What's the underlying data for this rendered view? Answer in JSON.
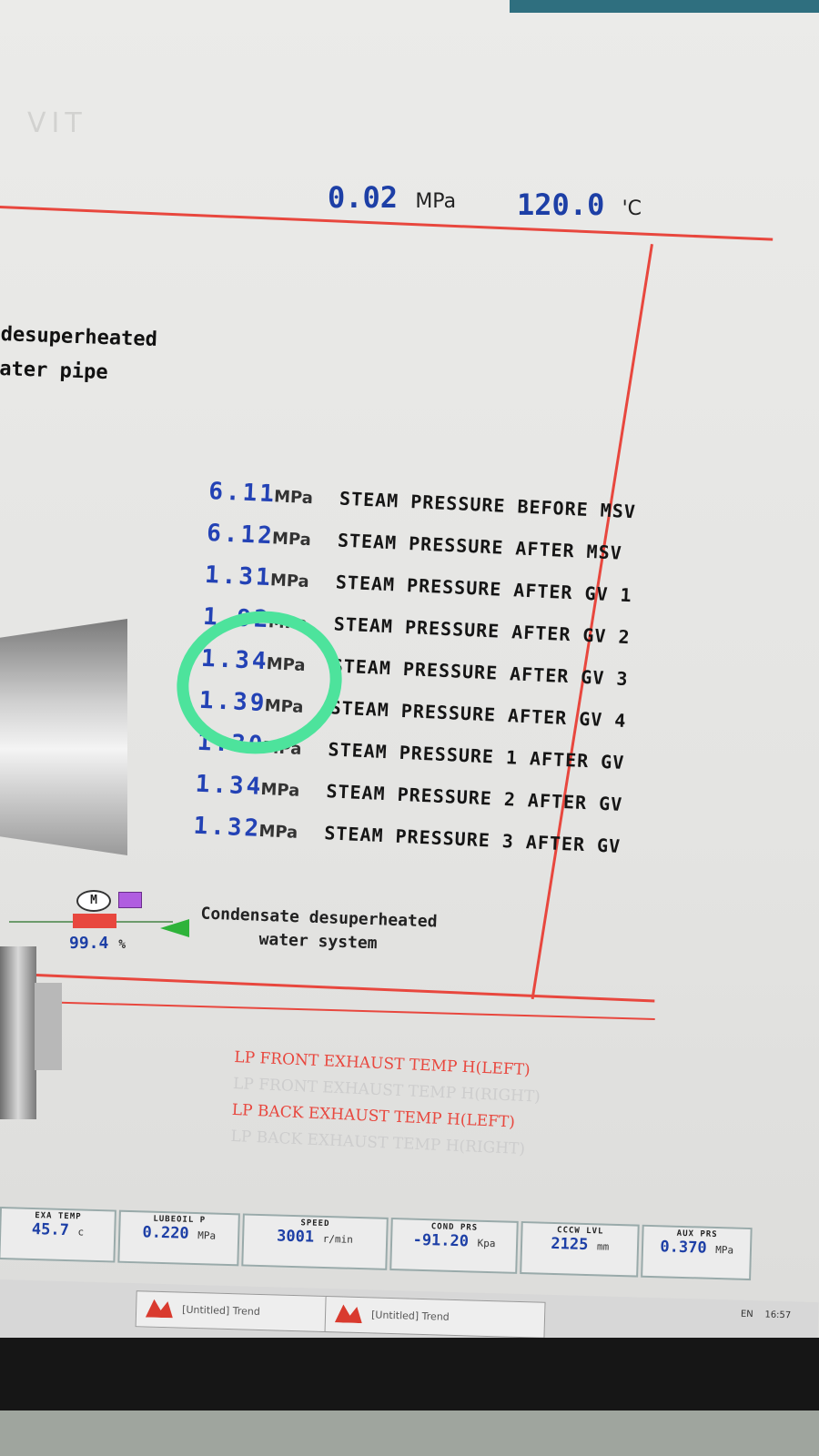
{
  "header": {
    "ghost_title": "VIT",
    "pressure_value": "0.02",
    "pressure_unit": "MPa",
    "temp_value": "120.0",
    "temp_unit": "'C"
  },
  "pipe_label": [
    "desuperheated",
    "ater pipe"
  ],
  "readings": [
    {
      "value": "6.11",
      "unit": "MPa",
      "label": "STEAM PRESSURE BEFORE MSV"
    },
    {
      "value": "6.12",
      "unit": "MPa",
      "label": "STEAM PRESSURE AFTER MSV"
    },
    {
      "value": "1.31",
      "unit": "MPa",
      "label": "STEAM PRESSURE AFTER GV 1"
    },
    {
      "value": "1.92",
      "unit": "MPa",
      "label": "STEAM PRESSURE AFTER GV 2"
    },
    {
      "value": "1.34",
      "unit": "MPa",
      "label": "STEAM PRESSURE AFTER GV 3"
    },
    {
      "value": "1.39",
      "unit": "MPa",
      "label": "STEAM PRESSURE AFTER GV 4"
    },
    {
      "value": "1.30",
      "unit": "MPa",
      "label": "STEAM PRESSURE 1 AFTER GV"
    },
    {
      "value": "1.34",
      "unit": "MPa",
      "label": "STEAM PRESSURE 2 AFTER GV"
    },
    {
      "value": "1.32",
      "unit": "MPa",
      "label": "STEAM PRESSURE 3 AFTER GV"
    }
  ],
  "valve": {
    "motor_label": "M",
    "percent": "99.4",
    "percent_unit": "%",
    "system_label_1": "Condensate desuperheated",
    "system_label_2": "water system"
  },
  "alarms": [
    {
      "text": "LP FRONT EXHAUST TEMP H(LEFT)",
      "active": true
    },
    {
      "text": "LP FRONT EXHAUST TEMP H(RIGHT)",
      "active": false
    },
    {
      "text": "LP BACK EXHAUST TEMP H(LEFT)",
      "active": true
    },
    {
      "text": "LP BACK EXHAUST TEMP H(RIGHT)",
      "active": false
    }
  ],
  "status_bar": [
    {
      "title": "EXA TEMP",
      "value": "45.7",
      "unit": "c"
    },
    {
      "title": "LUBEOIL P",
      "value": "0.220",
      "unit": "MPa"
    },
    {
      "title": "SPEED",
      "value": "3001",
      "unit": "r/min"
    },
    {
      "title": "COND PRS",
      "value": "-91.20",
      "unit": "Kpa"
    },
    {
      "title": "CCCW LVL",
      "value": "2125",
      "unit": "mm"
    },
    {
      "title": "AUX PRS",
      "value": "0.370",
      "unit": "MPa"
    }
  ],
  "taskbar": {
    "item1": "[Untitled] Trend",
    "item2": "[Untitled] Trend",
    "lang": "EN",
    "time": "16:57"
  },
  "colors": {
    "value_blue": "#2342b5",
    "frame_red": "#e8473e",
    "highlight_green": "#4de39c"
  }
}
